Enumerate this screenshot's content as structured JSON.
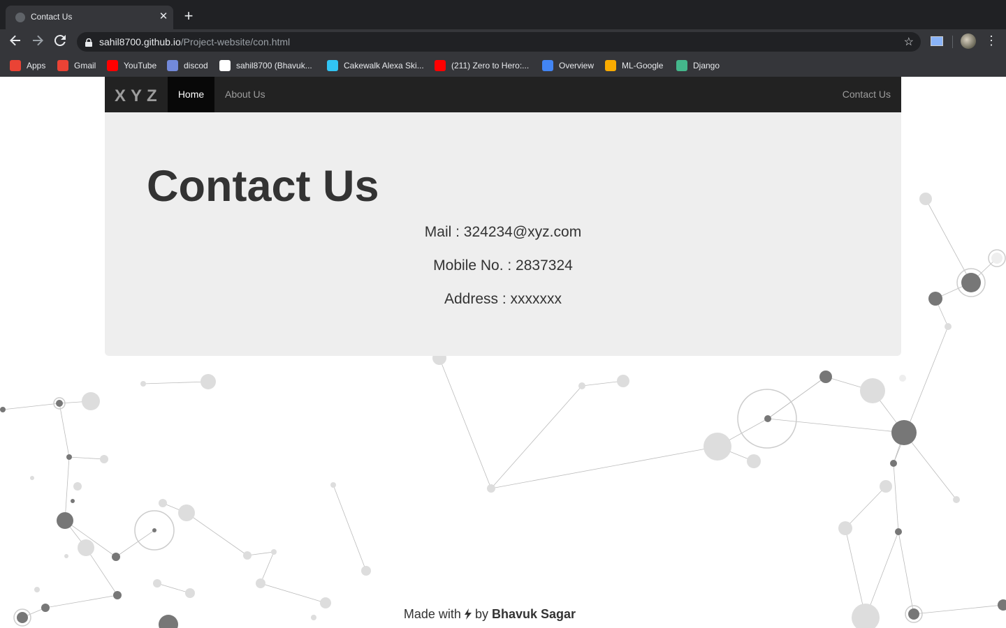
{
  "browser": {
    "tab_title": "Contact Us",
    "tab_close": "✕",
    "new_tab": "+",
    "url_host": "sahil8700.github.io",
    "url_path": "/Project-website/con.html",
    "bookmarks": [
      {
        "label": "Apps",
        "icon": "apps-grid-icon",
        "color": "#ea4335"
      },
      {
        "label": "Gmail",
        "icon": "gmail-icon",
        "color": "#ea4335"
      },
      {
        "label": "YouTube",
        "icon": "youtube-icon",
        "color": "#ff0000"
      },
      {
        "label": "discod",
        "icon": "discord-icon",
        "color": "#7289da"
      },
      {
        "label": "sahil8700 (Bhavuk...",
        "icon": "github-icon",
        "color": "#ffffff"
      },
      {
        "label": "Cakewalk Alexa Ski...",
        "icon": "alexa-icon",
        "color": "#31c4f3"
      },
      {
        "label": "(211) Zero to Hero:...",
        "icon": "youtube-icon",
        "color": "#ff0000"
      },
      {
        "label": "Overview",
        "icon": "google-assistant-icon",
        "color": "#4285f4"
      },
      {
        "label": "ML-Google",
        "icon": "google-colab-icon",
        "color": "#f9ab00"
      },
      {
        "label": "Django",
        "icon": "django-icon",
        "color": "#44b78b"
      }
    ]
  },
  "navbar": {
    "brand": "XYZ",
    "home": "Home",
    "about": "About Us",
    "contact": "Contact Us"
  },
  "contact": {
    "title": "Contact Us",
    "mail": "Mail : 324234@xyz.com",
    "mobile": "Mobile No. : 2837324",
    "address": "Address : xxxxxxx"
  },
  "footer": {
    "prefix": "Made with",
    "icon": "lightning-bolt-icon",
    "by": "by",
    "author": "Bhavuk Sagar"
  }
}
